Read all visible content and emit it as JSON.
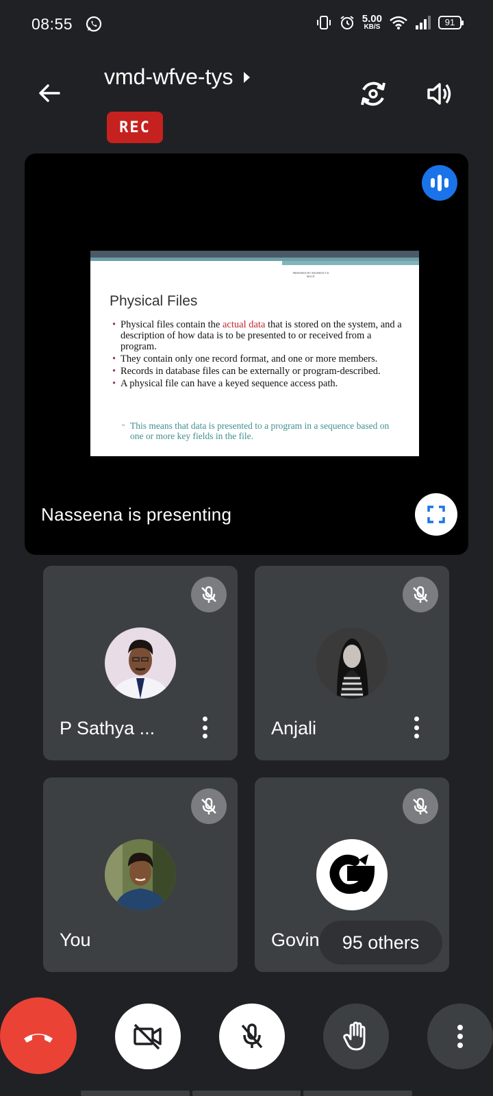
{
  "status_bar": {
    "time": "08:55",
    "net_speed_value": "5.00",
    "net_speed_unit": "KB/S",
    "battery": "91",
    "icons": [
      "whatsapp-icon",
      "vibrate-icon",
      "alarm-icon",
      "wifi-icon",
      "signal-icon",
      "battery-icon"
    ]
  },
  "header": {
    "meeting_code": "vmd-wfve-tys",
    "rec_label": "REC",
    "icons": [
      "back-arrow-icon",
      "switch-camera-icon",
      "volume-icon"
    ]
  },
  "presentation": {
    "presenter_label": "Nasseena is presenting",
    "slide": {
      "credit": "PREPARED BY SHAHEED T.K MSCIT",
      "title": "Physical Files",
      "bullet1_pre": "Physical files contain the ",
      "bullet1_red": "actual data",
      "bullet1_post": " that is stored on the system, and a description of how data is to be presented to or received from a program.",
      "bullet2": "They contain only one record format, and one or more members.",
      "bullet3": "Records in database files can be externally or program-described.",
      "bullet4": "A physical file can have a keyed sequence access path.",
      "sub_bullet": "This means that data is presented to a program in a sequence based on one or more key fields in the file."
    }
  },
  "participants": [
    {
      "name": "P Sathya ...",
      "muted": true
    },
    {
      "name": "Anjali",
      "muted": true
    },
    {
      "name": "You",
      "muted": true
    },
    {
      "name": "Govind",
      "muted": true
    }
  ],
  "others_label": "95 others",
  "controls": [
    "end-call",
    "camera-off",
    "mic-off",
    "raise-hand",
    "more-options"
  ],
  "colors": {
    "background": "#202124",
    "tile": "#3c4043",
    "end_call": "#ea4335",
    "rec": "#c5221f",
    "speaking": "#1a73e8"
  }
}
